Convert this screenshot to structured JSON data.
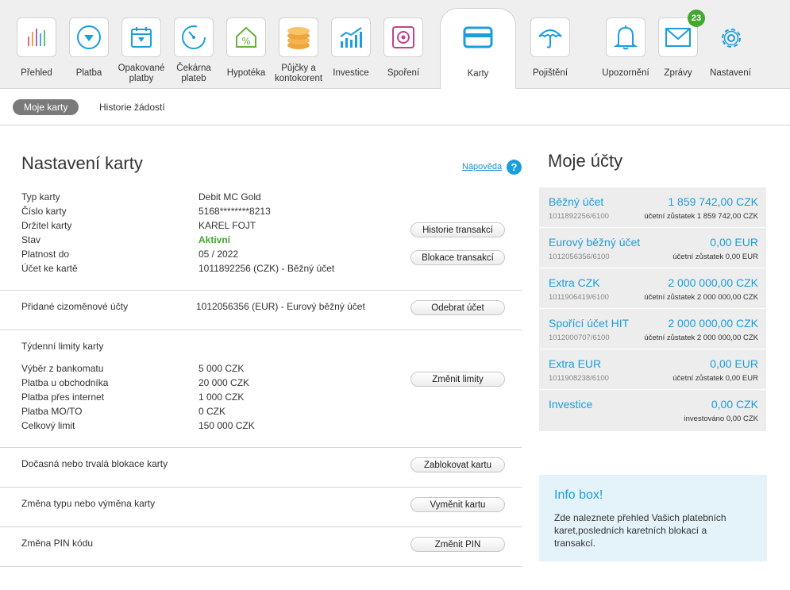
{
  "nav": {
    "items": [
      {
        "label": "Přehled",
        "icon": "bar-chart-icon"
      },
      {
        "label": "Platba",
        "icon": "payment-icon"
      },
      {
        "label": "Opakované platby",
        "icon": "calendar-icon"
      },
      {
        "label": "Čekárna plateb",
        "icon": "gauge-icon"
      },
      {
        "label": "Hypotéka",
        "icon": "house-percent-icon"
      },
      {
        "label": "Půjčky a kontokorent",
        "icon": "coins-icon"
      },
      {
        "label": "Investice",
        "icon": "investment-chart-icon"
      },
      {
        "label": "Spoření",
        "icon": "safe-icon"
      },
      {
        "label": "Karty",
        "icon": "card-icon"
      },
      {
        "label": "Pojištění",
        "icon": "umbrella-icon"
      },
      {
        "label": "Upozornění",
        "icon": "bell-icon"
      },
      {
        "label": "Zprávy",
        "icon": "envelope-icon",
        "badge": "23"
      },
      {
        "label": "Nastavení",
        "icon": "gear-icon"
      }
    ]
  },
  "subnav": {
    "active": "Moje karty",
    "other": "Historie žádostí"
  },
  "settings": {
    "title": "Nastavení karty",
    "help": "Nápověda",
    "help_icon": "?",
    "rows": [
      {
        "label": "Typ karty",
        "value": "Debit MC Gold"
      },
      {
        "label": "Číslo karty",
        "value": "5168********8213"
      },
      {
        "label": "Držitel karty",
        "value": "KAREL FOJT"
      },
      {
        "label": "Stav",
        "value": "Aktivní"
      },
      {
        "label": "Platnost do",
        "value": "05 / 2022"
      },
      {
        "label": "Účet ke kartě",
        "value": "1011892256 (CZK) - Běžný účet"
      }
    ],
    "btn_history": "Historie transakcí",
    "btn_block_tx": "Blokace transakcí",
    "foreign_label": "Přidané cizoměnové účty",
    "foreign_value": "1012056356 (EUR) - Eurový běžný účet",
    "btn_remove": "Odebrat účet",
    "limits_title": "Týdenní limity karty",
    "limits": [
      {
        "label": "Výběr z bankomatu",
        "value": "5 000 CZK"
      },
      {
        "label": "Platba u obchodníka",
        "value": "20 000 CZK"
      },
      {
        "label": "Platba přes internet",
        "value": "1 000 CZK"
      },
      {
        "label": "Platba MO/TO",
        "value": "0 CZK"
      },
      {
        "label": "Celkový limit",
        "value": "150 000 CZK"
      }
    ],
    "btn_limits": "Změnit limity",
    "block_label": "Dočasná nebo trvalá blokace karty",
    "btn_block": "Zablokovat kartu",
    "replace_label": "Změna typu nebo výměna karty",
    "btn_replace": "Vyměnit kartu",
    "pin_label": "Změna PIN kódu",
    "btn_pin": "Změnit PIN"
  },
  "accounts": {
    "title": "Moje účty",
    "items": [
      {
        "name": "Běžný účet",
        "amount": "1 859 742,00 CZK",
        "number": "1011892256/6100",
        "balance": "účetní zůstatek 1 859 742,00 CZK"
      },
      {
        "name": "Eurový běžný účet",
        "amount": "0,00 EUR",
        "number": "1012056356/6100",
        "balance": "účetní zůstatek 0,00 EUR"
      },
      {
        "name": "Extra CZK",
        "amount": "2 000 000,00 CZK",
        "number": "1011906419/6100",
        "balance": "účetní zůstatek 2 000 000,00 CZK"
      },
      {
        "name": "Spořící účet HIT",
        "amount": "2 000 000,00 CZK",
        "number": "1012000707/6100",
        "balance": "účetní zůstatek 2 000 000,00 CZK"
      },
      {
        "name": "Extra EUR",
        "amount": "0,00 EUR",
        "number": "1011908238/6100",
        "balance": "účetní zůstatek 0,00 EUR"
      },
      {
        "name": "Investice",
        "amount": "0,00 CZK",
        "number": "",
        "balance": "investováno 0,00 CZK"
      }
    ]
  },
  "infobox": {
    "title": "Info box!",
    "text": "Zde naleznete přehled Vašich platebních karet,posledních karetních blokací a transakcí."
  },
  "colors": {
    "accent": "#1a9edc",
    "active": "#43a82f",
    "pill": "#7a7a7a"
  }
}
